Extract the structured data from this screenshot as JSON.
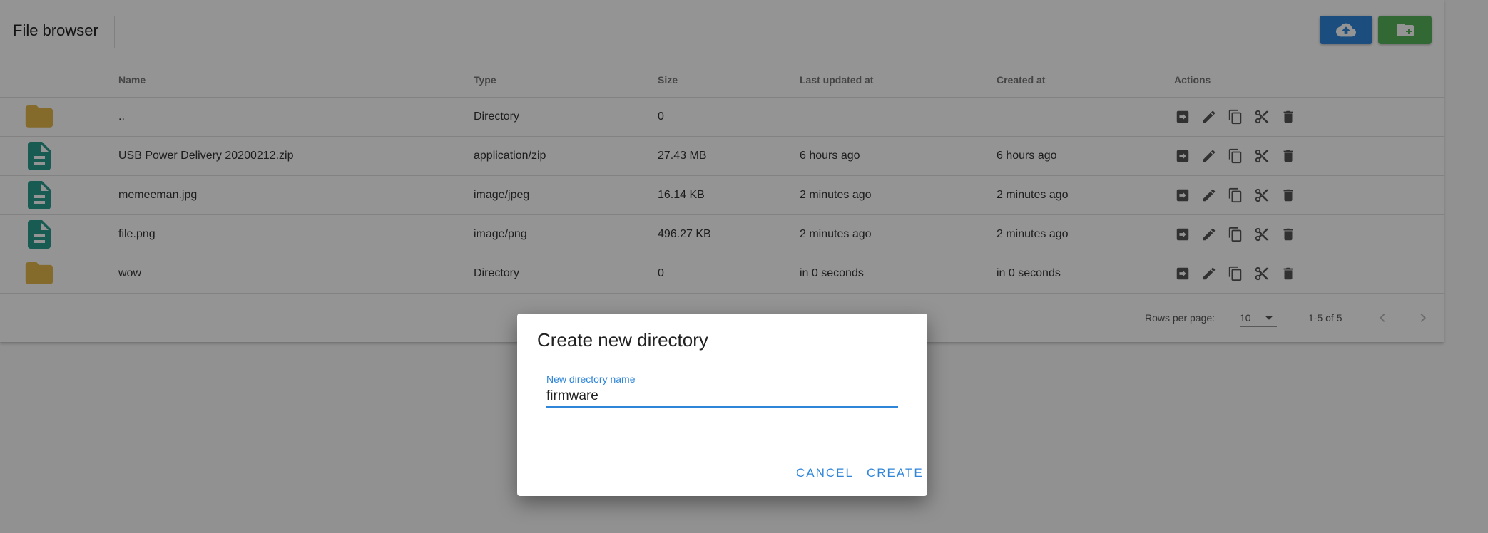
{
  "header": {
    "title": "File browser",
    "upload_icon": "cloud-upload-icon",
    "new_dir_icon": "create-new-folder-icon",
    "colors": {
      "upload": "#2f86d9",
      "new_dir": "#55b35a"
    }
  },
  "table": {
    "columns": [
      "Name",
      "Type",
      "Size",
      "Last updated at",
      "Created at",
      "Actions"
    ],
    "rows": [
      {
        "icon": "folder-icon",
        "name": "..",
        "type": "Directory",
        "size": "0",
        "updated": "",
        "created": ""
      },
      {
        "icon": "file-icon",
        "name": "USB Power Delivery 20200212.zip",
        "type": "application/zip",
        "size": "27.43 MB",
        "updated": "6 hours ago",
        "created": "6 hours ago"
      },
      {
        "icon": "file-icon",
        "name": "memeeman.jpg",
        "type": "image/jpeg",
        "size": "16.14 KB",
        "updated": "2 minutes ago",
        "created": "2 minutes ago"
      },
      {
        "icon": "file-icon",
        "name": "file.png",
        "type": "image/png",
        "size": "496.27 KB",
        "updated": "2 minutes ago",
        "created": "2 minutes ago"
      },
      {
        "icon": "folder-icon",
        "name": "wow",
        "type": "Directory",
        "size": "0",
        "updated": "in 0 seconds",
        "created": "in 0 seconds"
      }
    ],
    "row_actions": [
      "open-icon",
      "edit-icon",
      "copy-icon",
      "cut-icon",
      "delete-icon"
    ]
  },
  "pagination": {
    "rows_per_page_label": "Rows per page:",
    "rows_per_page": "10",
    "range": "1-5 of 5"
  },
  "dialog": {
    "title": "Create new directory",
    "field_label": "New directory name",
    "field_value": "firmware",
    "cancel_label": "CANCEL",
    "create_label": "CREATE"
  },
  "colors": {
    "accent": "#2f86d9",
    "folder": "#e6b84a",
    "file": "#2a9d8f",
    "icon_gray": "#555555"
  }
}
